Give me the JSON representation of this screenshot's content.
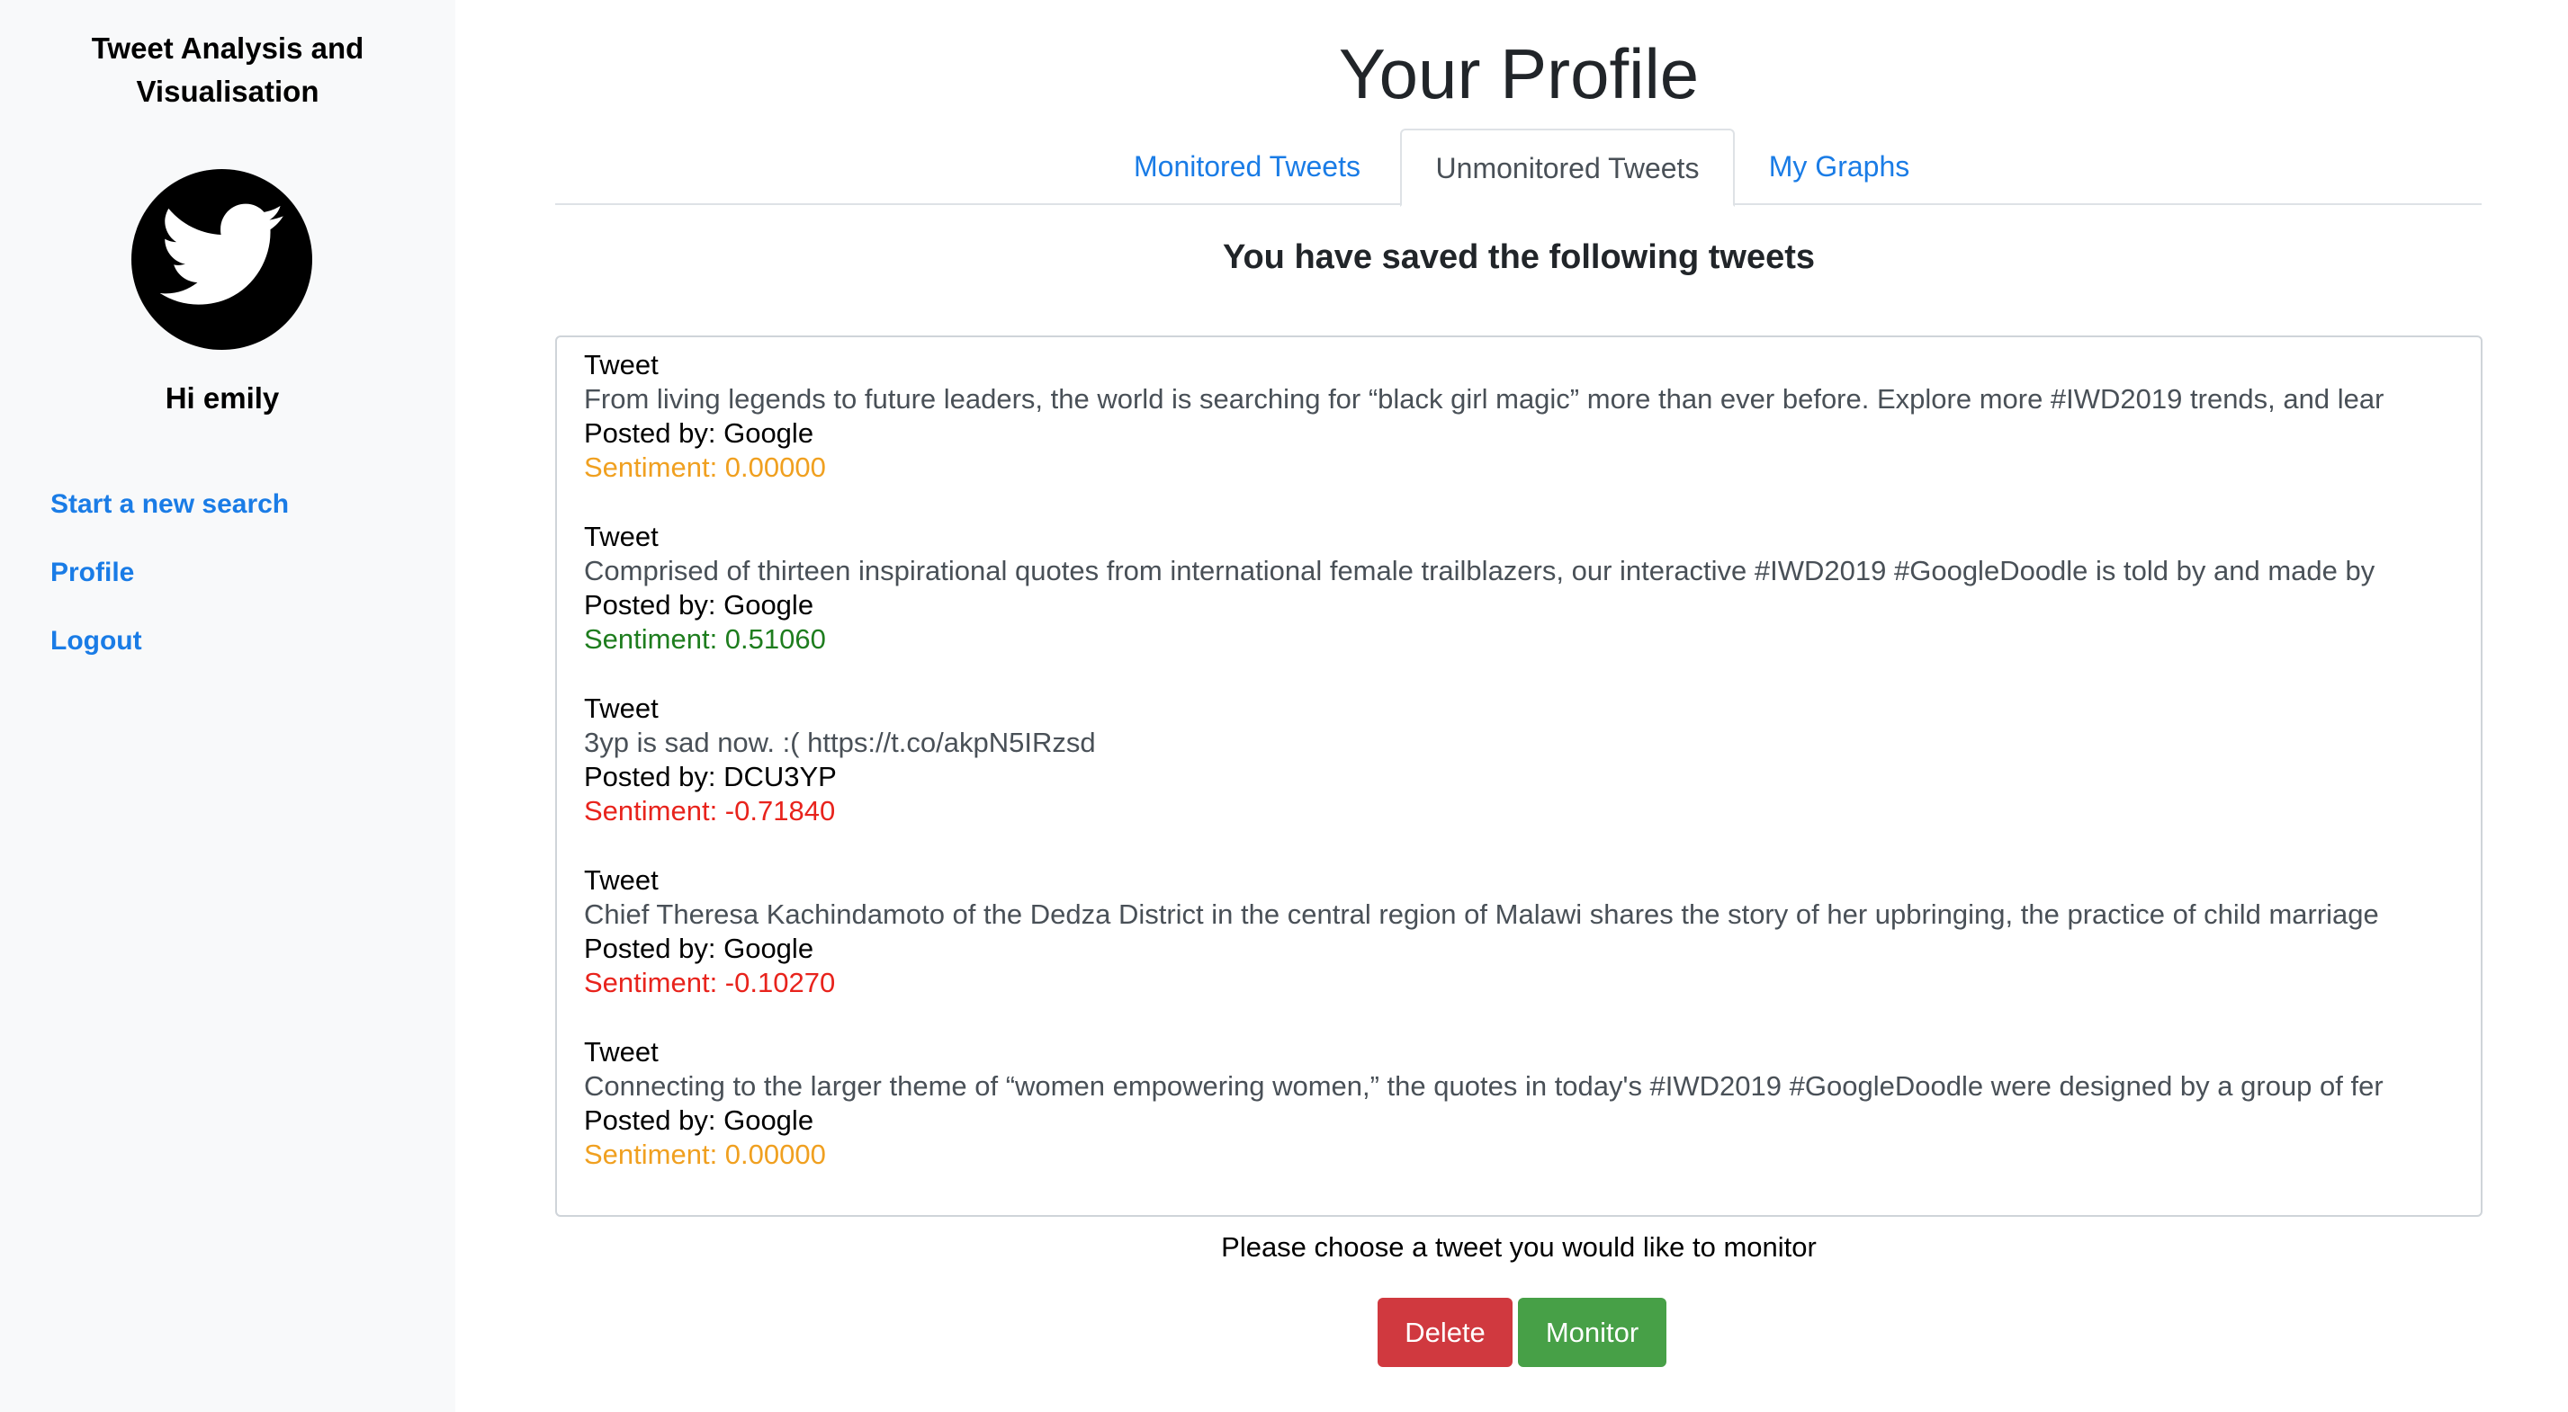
{
  "sidebar": {
    "app_title_line1": "Tweet Analysis and",
    "app_title_line2": "Visualisation",
    "avatar_icon": "twitter-bird-icon",
    "greeting": "Hi emily",
    "nav": [
      {
        "label": "Start a new search"
      },
      {
        "label": "Profile"
      },
      {
        "label": "Logout"
      }
    ]
  },
  "main": {
    "title": "Your Profile",
    "tabs": [
      {
        "label": "Monitored Tweets",
        "active": false
      },
      {
        "label": "Unmonitored Tweets",
        "active": true
      },
      {
        "label": "My Graphs",
        "active": false
      }
    ],
    "heading": "You have saved the following tweets",
    "tweets": [
      {
        "label": "Tweet",
        "text": "From living legends to future leaders, the world is searching for “black girl magic” more than ever before. Explore more #IWD2019 trends, and lear",
        "posted_by": "Posted by: Google",
        "sentiment": "Sentiment: 0.00000",
        "sentiment_color": "#f0a020"
      },
      {
        "label": "Tweet",
        "text": "Comprised of thirteen inspirational quotes from international female trailblazers, our interactive #IWD2019 #GoogleDoodle is told by and made by",
        "posted_by": "Posted by: Google",
        "sentiment": "Sentiment: 0.51060",
        "sentiment_color": "#1e7d1e"
      },
      {
        "label": "Tweet",
        "text": "3yp is sad now. :( https://t.co/akpN5IRzsd",
        "posted_by": "Posted by: DCU3YP",
        "sentiment": "Sentiment: -0.71840",
        "sentiment_color": "#e8231c"
      },
      {
        "label": "Tweet",
        "text": "Chief Theresa Kachindamoto of the Dedza District in the central region of Malawi shares the story of her upbringing, the practice of child marriage",
        "posted_by": "Posted by: Google",
        "sentiment": "Sentiment: -0.10270",
        "sentiment_color": "#e8231c"
      },
      {
        "label": "Tweet",
        "text": "Connecting to the larger theme of “women empowering women,” the quotes in today's #IWD2019 #GoogleDoodle were designed by a group of fer",
        "posted_by": "Posted by: Google",
        "sentiment": "Sentiment: 0.00000",
        "sentiment_color": "#f0a020"
      }
    ],
    "prompt": "Please choose a tweet you would like to monitor",
    "buttons": {
      "delete": "Delete",
      "monitor": "Monitor"
    }
  },
  "colors": {
    "link": "#1a7ce6",
    "delete": "#d0393f",
    "monitor": "#47a047",
    "sidebar_bg": "#f8f9fa"
  }
}
